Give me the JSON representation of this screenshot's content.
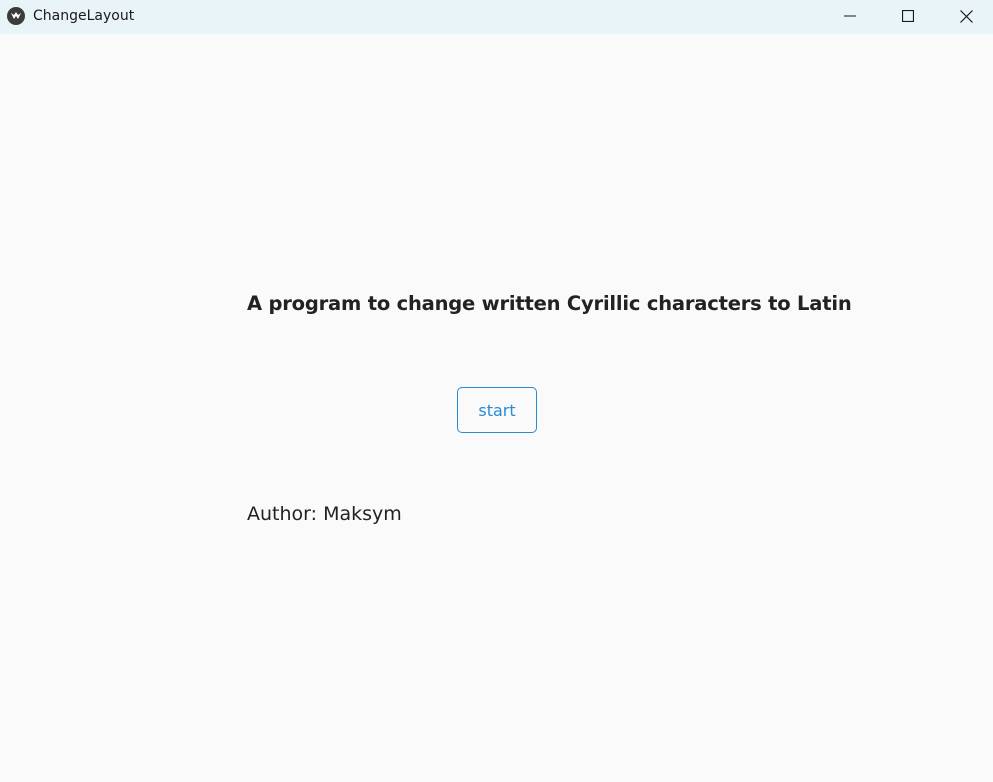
{
  "window": {
    "title": "ChangeLayout",
    "icon": "kivy-app-icon",
    "controls": [
      "minimize-icon",
      "maximize-icon",
      "close-icon"
    ]
  },
  "main": {
    "headline": "A program to change written Cyrillic characters to Latin",
    "start_label": "start",
    "author": "Author: Maksym"
  },
  "colors": {
    "titlebar_bg": "#e8f4f8",
    "content_bg": "#fafafa",
    "accent": "#2a8ad4",
    "text": "#222222"
  }
}
